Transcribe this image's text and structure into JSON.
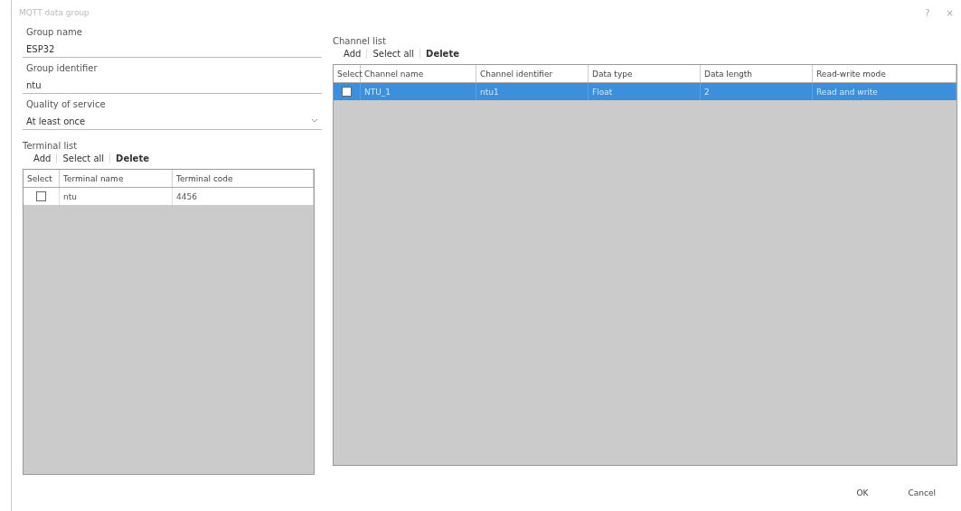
{
  "window": {
    "title": "MQTT data group",
    "help": "?",
    "close": "×"
  },
  "fields": [
    {
      "label": "Group name",
      "value": "ESP32",
      "kind": "text"
    },
    {
      "label": "Group identifier",
      "value": "ntu",
      "kind": "text"
    },
    {
      "label": "Quality of service",
      "value": "At least once",
      "kind": "dropdown"
    }
  ],
  "terminal_list": {
    "title": "Terminal list",
    "actions": [
      "Add",
      "Select all",
      "Delete"
    ],
    "columns": [
      "Select",
      "Terminal name",
      "Terminal code"
    ],
    "rows": [
      {
        "checked": false,
        "selected": false,
        "cells": [
          "",
          "ntu",
          "4456"
        ]
      }
    ]
  },
  "channel_list": {
    "title": "Channel list",
    "actions": [
      "Add",
      "Select all",
      "Delete"
    ],
    "columns": [
      "Select",
      "Channel name",
      "Channel identifier",
      "Data type",
      "Data length",
      "Read-write mode"
    ],
    "rows": [
      {
        "checked": false,
        "selected": true,
        "cells": [
          "",
          "NTU_1",
          "ntu1",
          "Float",
          "2",
          "Read and write"
        ]
      }
    ]
  },
  "buttons": [
    "OK",
    "Cancel"
  ]
}
